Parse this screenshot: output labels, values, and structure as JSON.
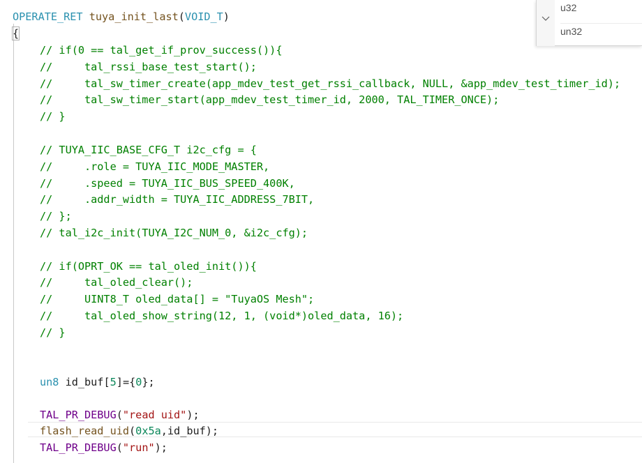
{
  "editor": {
    "signature": {
      "return_type": "OPERATE_RET",
      "func_name": "tuya_init_last",
      "open_paren": "(",
      "param": "VOID_T",
      "close_paren": ")"
    },
    "open_brace": "{",
    "block1": [
      "// if(0 == tal_get_if_prov_success()){",
      "//     tal_rssi_base_test_start();",
      "//     tal_sw_timer_create(app_mdev_test_get_rssi_callback, NULL, &app_mdev_test_timer_id);",
      "//     tal_sw_timer_start(app_mdev_test_timer_id, 2000, TAL_TIMER_ONCE);",
      "// }"
    ],
    "block2": [
      "// TUYA_IIC_BASE_CFG_T i2c_cfg = {",
      "//     .role = TUYA_IIC_MODE_MASTER,",
      "//     .speed = TUYA_IIC_BUS_SPEED_400K,",
      "//     .addr_width = TUYA_IIC_ADDRESS_7BIT,",
      "// };",
      "// tal_i2c_init(TUYA_I2C_NUM_0, &i2c_cfg);"
    ],
    "block3": [
      "// if(OPRT_OK == tal_oled_init()){",
      "//     tal_oled_clear();",
      "//     UINT8_T oled_data[] = \"TuyaOS Mesh\";",
      "//     tal_oled_show_string(12, 1, (void*)oled_data, 16);",
      "// }"
    ],
    "decl": {
      "type": "un8",
      "space": " ",
      "name": "id_buf",
      "bracket_open": "[",
      "size": "5",
      "bracket_close": "]",
      "assign": "={",
      "init": "0",
      "close": "};"
    },
    "debug1": {
      "macro": "TAL_PR_DEBUG",
      "open": "(",
      "arg": "\"read uid\"",
      "close": ");"
    },
    "read_call": {
      "func": "flash_read_uid",
      "open": "(",
      "arg1": "0x5a",
      "sep": ",",
      "arg2": "id_buf",
      "close": ");"
    },
    "debug2": {
      "macro": "TAL_PR_DEBUG",
      "open": "(",
      "arg": "\"run\"",
      "close": ");"
    }
  },
  "completion": {
    "items": [
      "u32",
      "un32"
    ],
    "chevron_icon": "chevron-down-icon"
  },
  "colors": {
    "type": "#2b91af",
    "keyword": "#0000ff",
    "function": "#74531f",
    "comment": "#008000",
    "string": "#a31515",
    "number": "#098658",
    "macro": "#6f008a"
  }
}
